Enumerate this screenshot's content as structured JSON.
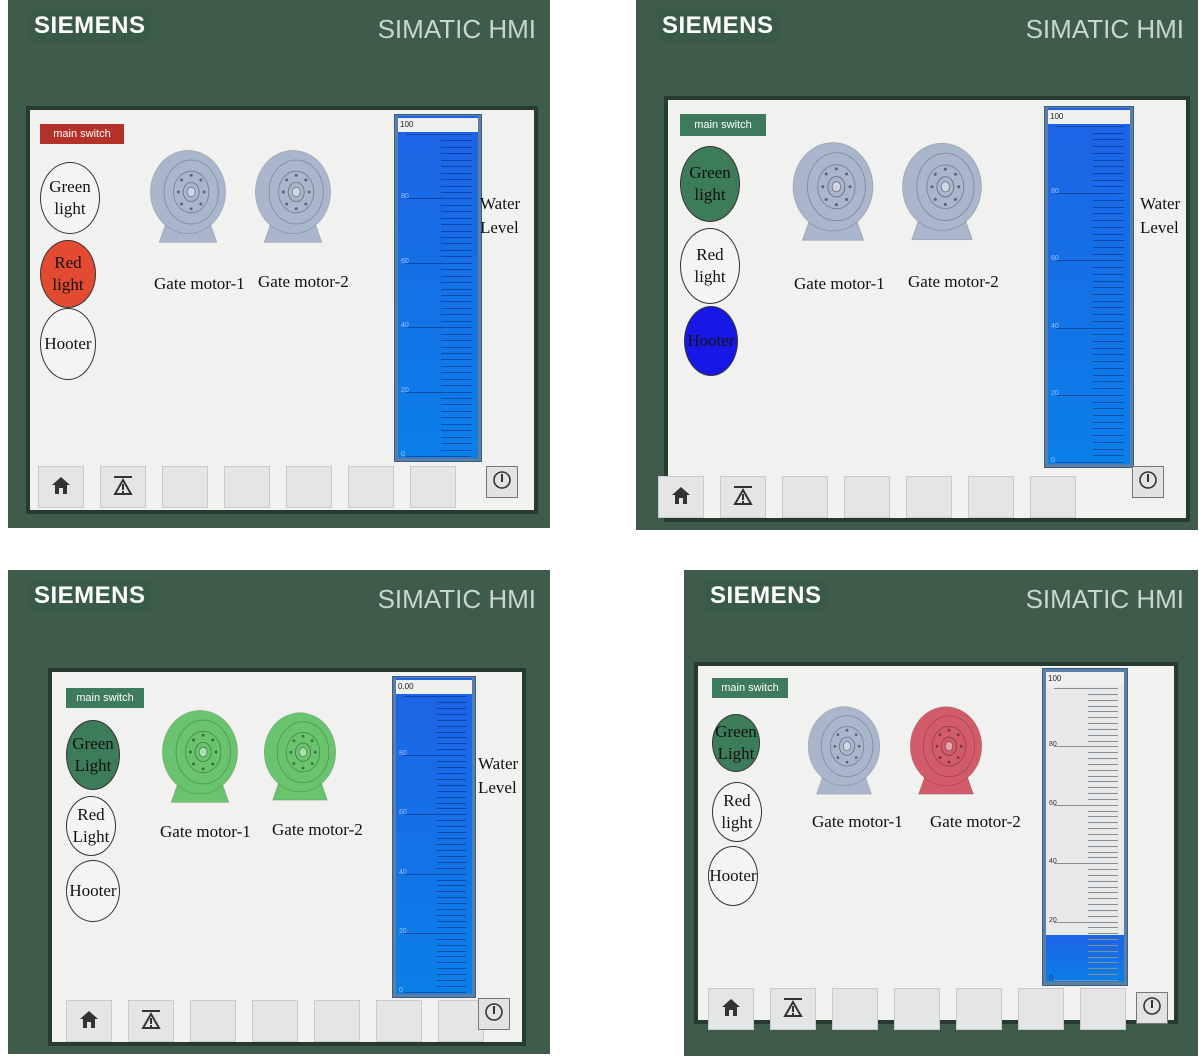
{
  "colors": {
    "bezel": "#3f5c4a",
    "screen": "#f1f1ef",
    "switch_on": "#3e7a5c",
    "switch_off": "#b5322a",
    "lamp_green": "#3d7c59",
    "lamp_red": "#e24a32",
    "lamp_blue": "#1818e6",
    "motor_grey": "#a9b6cc",
    "motor_green": "#69c46d",
    "motor_red": "#d15b69",
    "tank_blue": "#1e63e6"
  },
  "panels": [
    {
      "brand": "SIEMENS",
      "model": "SIMATIC HMI",
      "main_switch": {
        "label": "main switch",
        "state": "off"
      },
      "lamps": [
        {
          "label": "Green light",
          "state": "off",
          "color": "none"
        },
        {
          "label": "Red light",
          "state": "on",
          "color": "red"
        },
        {
          "label": "Hooter",
          "state": "off",
          "color": "none"
        }
      ],
      "motors": [
        {
          "label": "Gate motor-1",
          "color": "grey"
        },
        {
          "label": "Gate motor-2",
          "color": "grey"
        }
      ],
      "tank": {
        "top_label": "100",
        "level_percent": 100,
        "ticks": [
          "80",
          "60",
          "40",
          "20",
          "0"
        ]
      },
      "water_label": [
        "Water",
        "Level"
      ]
    },
    {
      "brand": "SIEMENS",
      "model": "SIMATIC HMI",
      "main_switch": {
        "label": "main switch",
        "state": "on"
      },
      "lamps": [
        {
          "label": "Green light",
          "state": "on",
          "color": "green"
        },
        {
          "label": "Red light",
          "state": "off",
          "color": "none"
        },
        {
          "label": "Hooter",
          "state": "on",
          "color": "blue"
        }
      ],
      "motors": [
        {
          "label": "Gate motor-1",
          "color": "grey"
        },
        {
          "label": "Gate motor-2",
          "color": "grey"
        }
      ],
      "tank": {
        "top_label": "100",
        "level_percent": 100,
        "ticks": [
          "80",
          "60",
          "40",
          "20",
          "0"
        ]
      },
      "water_label": [
        "Water",
        "Level"
      ]
    },
    {
      "brand": "SIEMENS",
      "model": "SIMATIC HMI",
      "main_switch": {
        "label": "main switch",
        "state": "on"
      },
      "lamps": [
        {
          "label": "Green Light",
          "state": "on",
          "color": "green"
        },
        {
          "label": "Red Light",
          "state": "off",
          "color": "none"
        },
        {
          "label": "Hooter",
          "state": "off",
          "color": "none"
        }
      ],
      "motors": [
        {
          "label": "Gate motor-1",
          "color": "green"
        },
        {
          "label": "Gate motor-2",
          "color": "green"
        }
      ],
      "tank": {
        "top_label": "0.00",
        "level_percent": 100,
        "ticks": [
          "80",
          "60",
          "40",
          "20",
          "0"
        ]
      },
      "water_label": [
        "Water",
        "Level"
      ]
    },
    {
      "brand": "SIEMENS",
      "model": "SIMATIC HMI",
      "main_switch": {
        "label": "main switch",
        "state": "on"
      },
      "lamps": [
        {
          "label": "Green Light",
          "state": "on",
          "color": "green"
        },
        {
          "label": "Red light",
          "state": "off",
          "color": "none"
        },
        {
          "label": "Hooter",
          "state": "off",
          "color": "none"
        }
      ],
      "motors": [
        {
          "label": "Gate motor-1",
          "color": "grey"
        },
        {
          "label": "Gate motor-2",
          "color": "red"
        }
      ],
      "tank": {
        "top_label": "100",
        "level_percent": 15,
        "ticks": [
          "80",
          "60",
          "40",
          "20",
          "0"
        ]
      },
      "water_label": []
    }
  ]
}
